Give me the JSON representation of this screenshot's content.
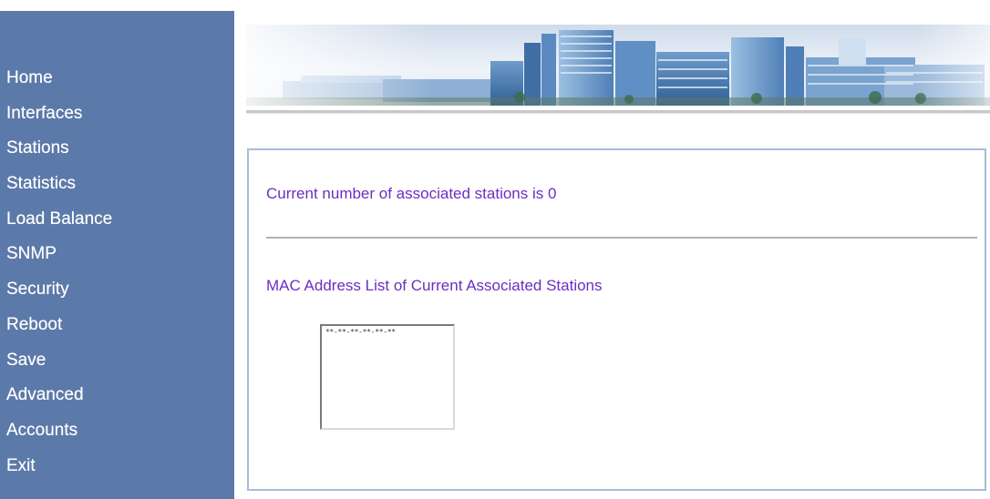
{
  "sidebar": {
    "items": [
      {
        "label": "Home"
      },
      {
        "label": "Interfaces"
      },
      {
        "label": "Stations"
      },
      {
        "label": "Statistics"
      },
      {
        "label": "Load Balance"
      },
      {
        "label": "SNMP"
      },
      {
        "label": "Security"
      },
      {
        "label": "Reboot"
      },
      {
        "label": "Save"
      },
      {
        "label": "Advanced"
      },
      {
        "label": "Accounts"
      },
      {
        "label": "Exit"
      }
    ]
  },
  "banner": {
    "image": "building-skyline-banner"
  },
  "main": {
    "associated_count_text": "Current number of associated stations is 0",
    "mac_list_title": "MAC Address List of Current Associated Stations",
    "mac_list": {
      "options": [
        "**-**-**-**-**-**"
      ]
    }
  },
  "colors": {
    "sidebar_bg": "#5b79a9",
    "sidebar_text": "#ffffff",
    "content_text": "#6b2fc0",
    "panel_border": "#a9bcd9"
  }
}
